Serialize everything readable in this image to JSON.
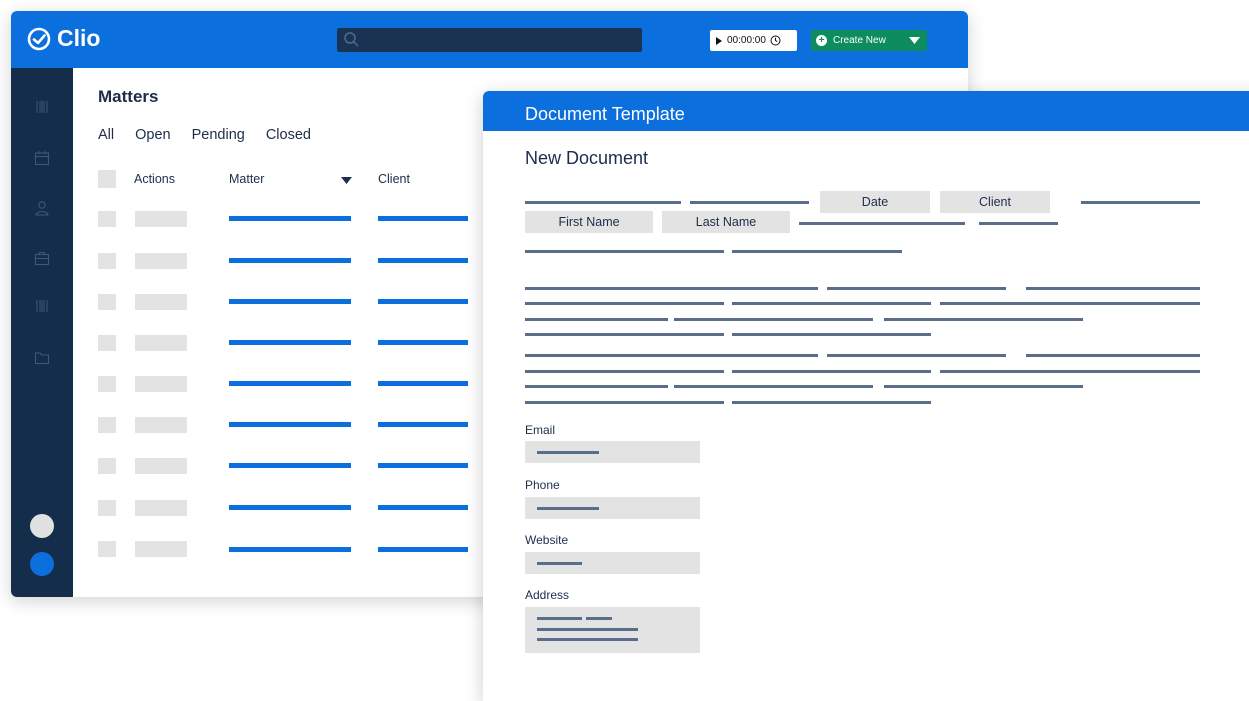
{
  "app": {
    "logo_text": "Clio",
    "timer_text": "00:00:00",
    "create_new_label": "Create New",
    "brand_color": "#0b6fdd",
    "sidebar_color": "#132d4a",
    "create_color": "#0d8d5e"
  },
  "sidebar": {
    "icons": [
      "barcode-icon",
      "calendar-icon",
      "user-icon",
      "briefcase-icon",
      "barcode-icon",
      "folder-icon"
    ]
  },
  "matters": {
    "title": "Matters",
    "tabs": [
      "All",
      "Open",
      "Pending",
      "Closed"
    ],
    "columns": {
      "actions": "Actions",
      "matter": "Matter",
      "client": "Client"
    }
  },
  "doc": {
    "header_title": "Document Template",
    "title": "New Document",
    "chips": {
      "date": "Date",
      "client": "Client",
      "first_name": "First Name",
      "last_name": "Last Name"
    },
    "fields": {
      "email": "Email",
      "phone": "Phone",
      "website": "Website",
      "address": "Address"
    }
  }
}
